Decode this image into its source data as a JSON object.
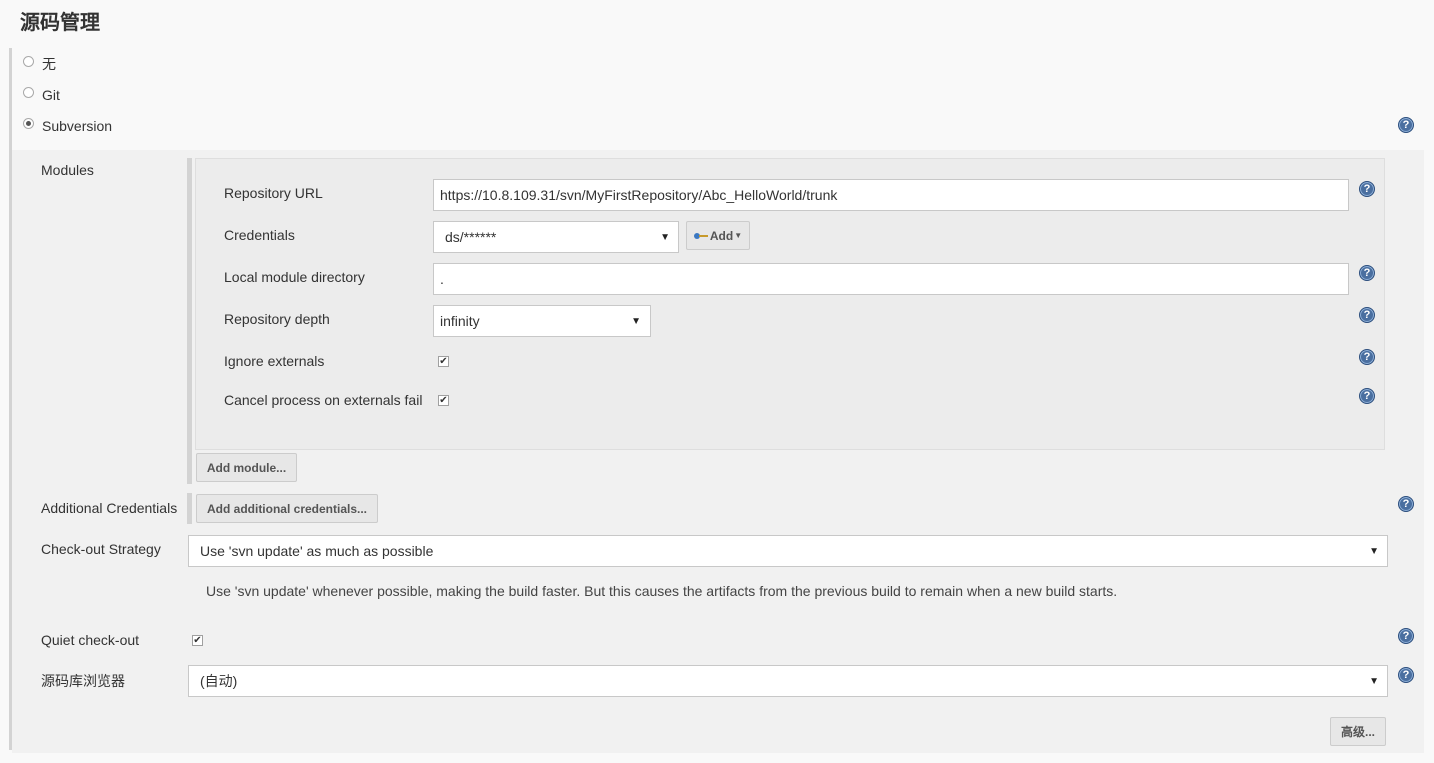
{
  "section_title": "源码管理",
  "scm_options": [
    {
      "label": "无",
      "selected": false
    },
    {
      "label": "Git",
      "selected": false
    },
    {
      "label": "Subversion",
      "selected": true
    }
  ],
  "modules": {
    "label": "Modules",
    "repository_url": {
      "label": "Repository URL",
      "value": "https://10.8.109.31/svn/MyFirstRepository/Abc_HelloWorld/trunk"
    },
    "credentials": {
      "label": "Credentials",
      "value": "ds/******",
      "add_button": "Add"
    },
    "local_module_directory": {
      "label": "Local module directory",
      "value": "."
    },
    "repository_depth": {
      "label": "Repository depth",
      "value": "infinity"
    },
    "ignore_externals": {
      "label": "Ignore externals",
      "checked": true
    },
    "cancel_on_externals_fail": {
      "label": "Cancel process on externals fail",
      "checked": true
    },
    "add_module_button": "Add module..."
  },
  "additional_credentials": {
    "label": "Additional Credentials",
    "button": "Add additional credentials..."
  },
  "checkout_strategy": {
    "label": "Check-out Strategy",
    "value": "Use 'svn update' as much as possible",
    "description": "Use 'svn update' whenever possible, making the build faster. But this causes the artifacts from the previous build to remain when a new build starts."
  },
  "quiet_checkout": {
    "label": "Quiet check-out",
    "checked": true
  },
  "repo_browser": {
    "label": "源码库浏览器",
    "value": "(自动)"
  },
  "advanced_button": "高级...",
  "icons": {
    "help": "help-icon",
    "dropdown": "chevron-down-icon",
    "key": "key-icon"
  },
  "colors": {
    "help_icon": "#4a6fa0",
    "panel_bg": "#f1f1f1",
    "module_bg": "#ececec"
  }
}
